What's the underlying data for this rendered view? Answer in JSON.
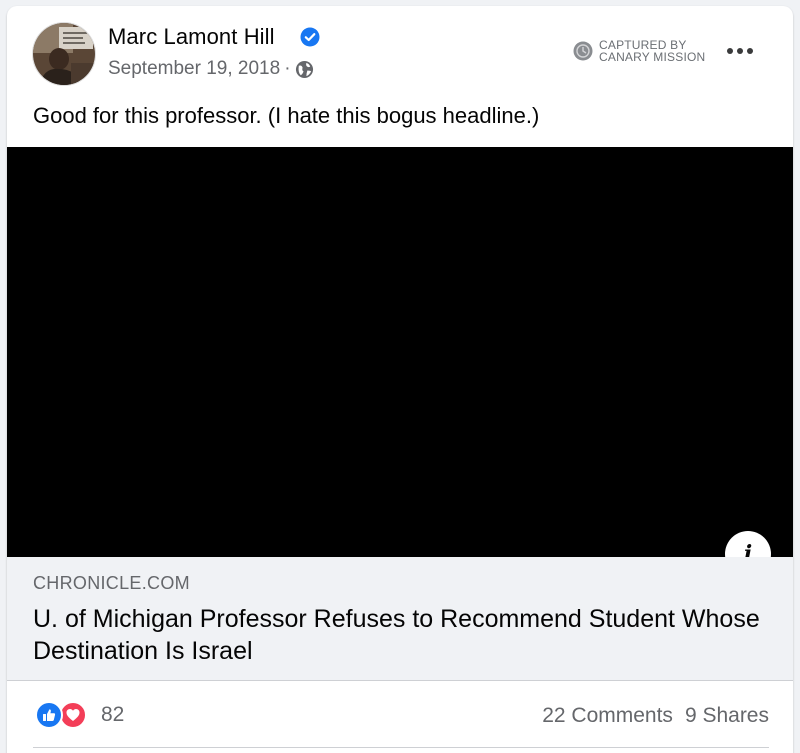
{
  "post": {
    "author": "Marc Lamont Hill",
    "date": "September 19, 2018",
    "date_separator": "·",
    "privacy_icon": "globe-icon",
    "verified_icon": "verified-badge-icon",
    "captured_line1": "CAPTURED BY",
    "captured_line2": "CANARY MISSION",
    "more_icon": "more-options-icon",
    "text": "Good for this professor. (I hate this bogus headline.)"
  },
  "link": {
    "domain": "CHRONICLE.COM",
    "headline": "U. of Michigan Professor Refuses to Recommend Student Whose Destination Is Israel",
    "info_label": "i"
  },
  "stats": {
    "reaction_count": "82",
    "comments": "22 Comments",
    "shares": "9 Shares"
  },
  "colors": {
    "accent": "#1877f2",
    "love": "#f33e58",
    "secondary_text": "#65676b",
    "media_bg": "#000000"
  }
}
